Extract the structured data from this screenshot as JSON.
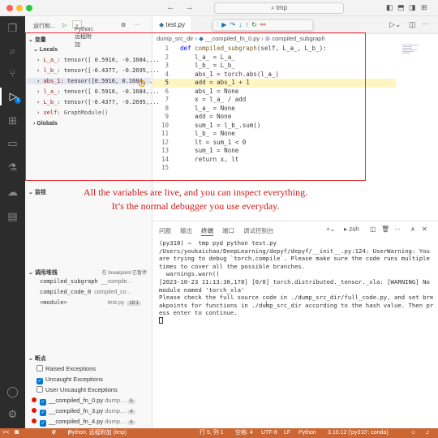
{
  "titlebar": {
    "search": "tmp"
  },
  "sidebar": {
    "run_label": "运行和...",
    "config": "Python: 远程附加",
    "variables_title": "变量",
    "locals_title": "Locals",
    "variables": [
      {
        "name": "L_a_",
        "value": "tensor([ 0.5916, -0.1684,..."
      },
      {
        "name": "l_b_",
        "value": "tensor([-0.4377, -0.2695,..."
      },
      {
        "name": "abs_1",
        "value": "tensor([0.5916, 0.1684, ..."
      },
      {
        "name": "l_a_",
        "value": "tensor([ 0.5916, -0.1684,..."
      },
      {
        "name": "L_b_",
        "value": "tensor([-0.4377, -0.2695,..."
      },
      {
        "name": "self",
        "value": "GraphModule()"
      }
    ],
    "globals_title": "Globals",
    "watch_title": "监视",
    "callstack_title": "调用堆栈",
    "callstack_status": "在 breakpoint 已暂停",
    "callstack": [
      {
        "fn": "compiled_subgraph",
        "file": "__compile..."
      },
      {
        "fn": "compiled_code_0",
        "file": "compiled_co..."
      },
      {
        "fn": "<module>",
        "file": "test.py",
        "line": "18:1"
      }
    ],
    "breakpoints_title": "断点",
    "exceptions": [
      {
        "label": "Raised Exceptions",
        "checked": false
      },
      {
        "label": "Uncaught Exceptions",
        "checked": true
      },
      {
        "label": "User Uncaught Exceptions",
        "checked": false
      }
    ],
    "breakpoints": [
      {
        "file": "__compiled_fn_0.py",
        "dir": "dump...",
        "count": "5"
      },
      {
        "file": "__compiled_fn_3.py",
        "dir": "dump...",
        "count": "4"
      },
      {
        "file": "__compiled_fn_4.py",
        "dir": "dump...",
        "count": "4"
      }
    ]
  },
  "editor": {
    "tab": "test.py",
    "breadcrumb": {
      "folder": "dump_src_dir",
      "file": "__compiled_fn_0.py",
      "symbol": "compiled_subgraph"
    },
    "current_line": 5,
    "lines": [
      {
        "n": "1",
        "text": "def compiled_subgraph(self, L_a_, L_b_):"
      },
      {
        "n": "2",
        "text": "    l_a_ = L_a_"
      },
      {
        "n": "3",
        "text": "    l_b_ = L_b_"
      },
      {
        "n": "4",
        "text": "    abs_1 = torch.abs(l_a_)"
      },
      {
        "n": "5",
        "text": "    add = abs_1 + 1"
      },
      {
        "n": "6",
        "text": "    abs_1 = None"
      },
      {
        "n": "7",
        "text": "    x = l_a_ / add"
      },
      {
        "n": "8",
        "text": "    l_a_ = None"
      },
      {
        "n": "9",
        "text": "    add = None"
      },
      {
        "n": "10",
        "text": "    sum_1 = l_b_.sum()"
      },
      {
        "n": "11",
        "text": "    l_b_ = None"
      },
      {
        "n": "12",
        "text": "    lt = sum_1 < 0"
      },
      {
        "n": "13",
        "text": "    sum_1 = None"
      },
      {
        "n": "14",
        "text": "    return x, lt"
      },
      {
        "n": "15",
        "text": ""
      }
    ]
  },
  "caption": {
    "line1": "All the variables are live, and you can inspect everything.",
    "line2": "It’s the normal debugger you use everyday."
  },
  "panel": {
    "tabs": [
      "问题",
      "输出",
      "终端",
      "端口",
      "调试控制台"
    ],
    "active_tab": "终端",
    "shell": "zsh",
    "terminal": [
      "(py310) →  tmp pyd python test.py",
      "/Users/youkaichao/DeepLearning/depyf/depyf/__init__.py:124: UserWarning: You",
      "are trying to debug `torch.compile`. Please make sure the code runs multiple",
      "times to cover all the possible branches.",
      "  warnings.warn((",
      "[2023-10-23 11:13:30,178] [0/0] torch.distributed._tensor._xla: [WARNING] No",
      "module named 'torch_xla'",
      "Please check the full source code in ./dump_src_dir/full_code.py, and set bre",
      "akpoints for functions in ./dump_src_dir according to the hash value. Then pr",
      "ess enter to continue."
    ]
  },
  "statusbar": {
    "remote": "><",
    "errors": "0",
    "warnings": "0",
    "debug": "0",
    "config": "Python: 远程附加 (tmp)",
    "position": "行 5, 列 1",
    "spaces": "空格: 4",
    "encoding": "UTF-8",
    "eol": "LF",
    "language": "Python",
    "interpreter": "3.10.12 ('py310': conda)"
  },
  "colors": {
    "statusbar": "#cc6633",
    "caption": "#d11a1a",
    "highlight_line": "#fff5c2"
  }
}
